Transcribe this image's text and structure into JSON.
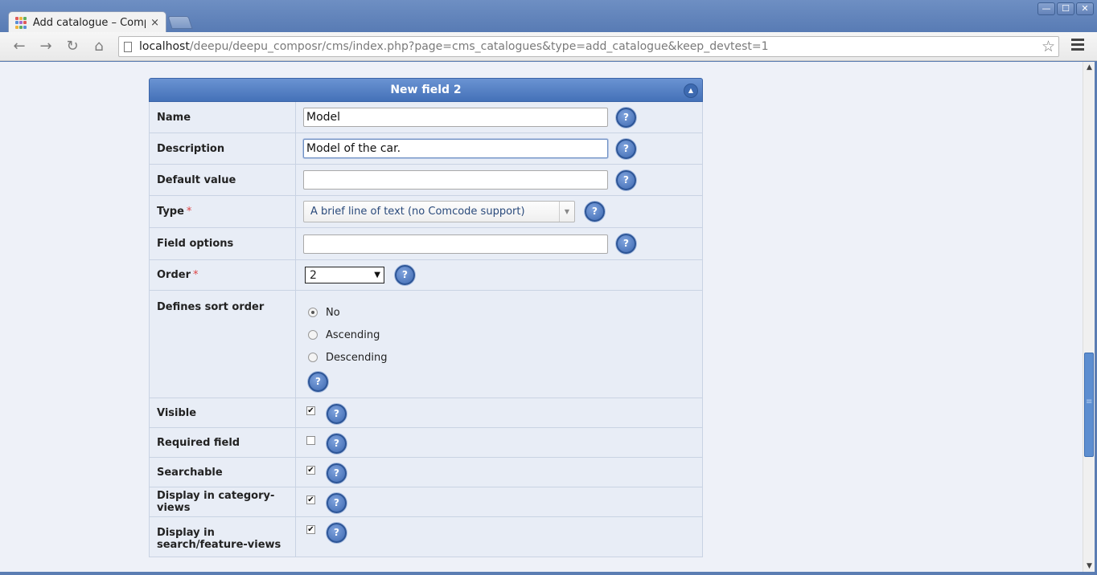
{
  "browser": {
    "tab_title": "Add catalogue – Compo",
    "tab_close": "×",
    "url_host": "localhost",
    "url_path": "/deepu/deepu_composr/cms/index.php?page=cms_catalogues&type=add_catalogue&keep_devtest=1",
    "window_controls": [
      "—",
      "☐",
      "✕"
    ]
  },
  "panel": {
    "title": "New field 2",
    "fields": {
      "name": {
        "label": "Name",
        "value": "Model"
      },
      "description": {
        "label": "Description",
        "value": "Model of the car."
      },
      "default_value": {
        "label": "Default value",
        "value": ""
      },
      "type": {
        "label": "Type",
        "required_mark": "*",
        "selected": "A brief line of text (no Comcode support)"
      },
      "field_options": {
        "label": "Field options",
        "value": ""
      },
      "order": {
        "label": "Order",
        "required_mark": "*",
        "selected": "2"
      },
      "sort_order": {
        "label": "Defines sort order",
        "options": [
          "No",
          "Ascending",
          "Descending"
        ],
        "selected": "No"
      },
      "visible": {
        "label": "Visible",
        "checked": true
      },
      "required_field": {
        "label": "Required field",
        "checked": false
      },
      "searchable": {
        "label": "Searchable",
        "checked": true
      },
      "category_views": {
        "label": "Display in category-views",
        "checked": true
      },
      "search_feature_views": {
        "label": "Display in search/feature-views",
        "checked": true
      }
    }
  },
  "help_label": "?",
  "colors": {
    "panel_header": "#4a77bd",
    "row_bg": "#e8edf6",
    "help_icon": "#3e69b1",
    "required_star": "#dd4444"
  }
}
